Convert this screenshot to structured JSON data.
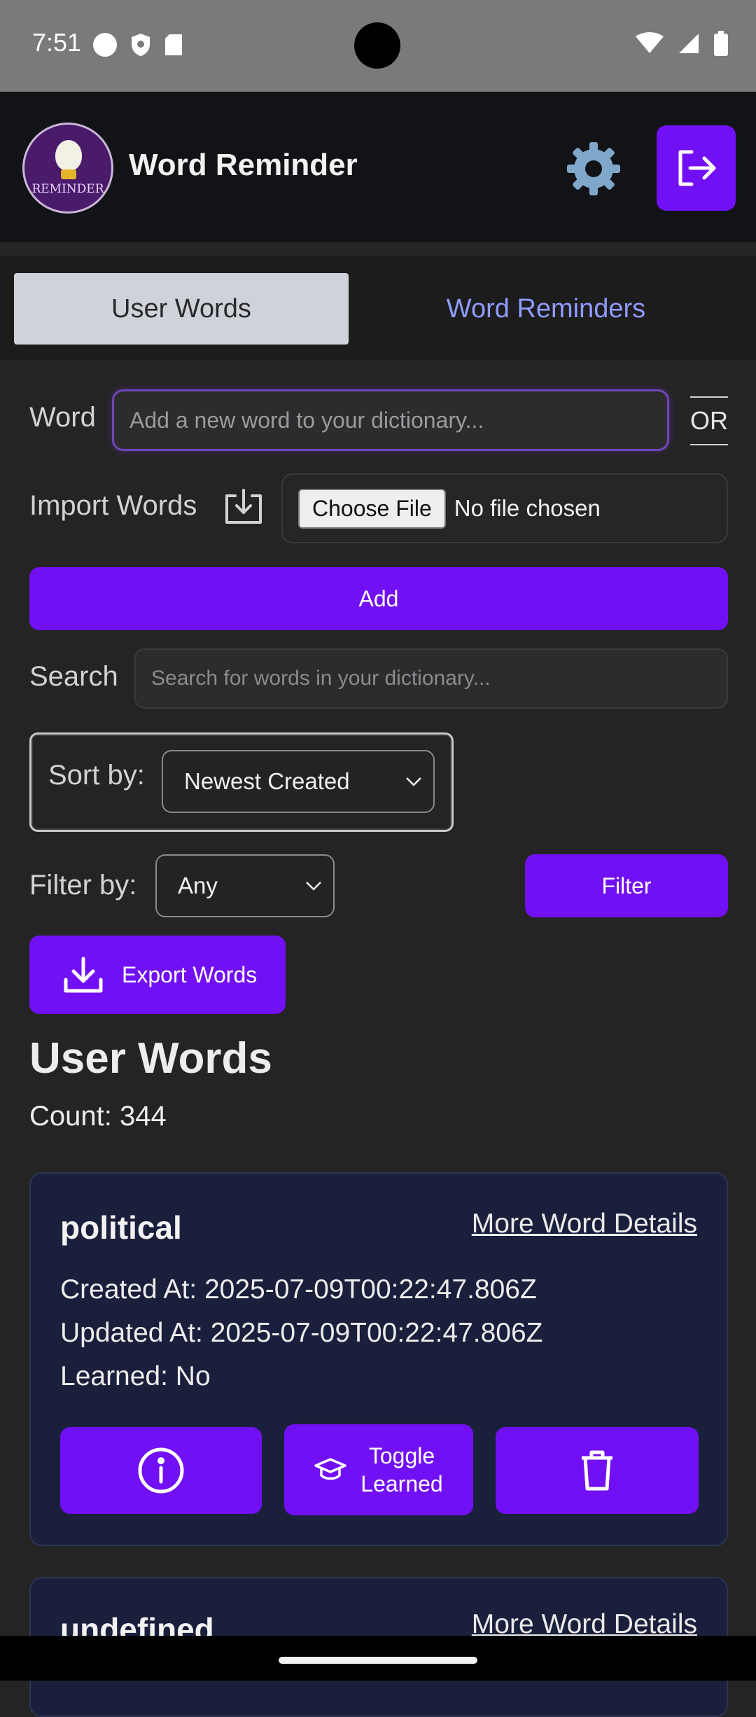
{
  "status_bar": {
    "time": "7:51"
  },
  "header": {
    "title": "Word Reminder",
    "logo_text": "REMINDER"
  },
  "tabs": {
    "user_words": "User Words",
    "word_reminders": "Word Reminders"
  },
  "form": {
    "word_label": "Word",
    "word_placeholder": "Add a new word to your dictionary...",
    "or_text": "OR",
    "import_label": "Import Words",
    "choose_file_label": "Choose File",
    "no_file_text": "No file chosen",
    "add_label": "Add",
    "search_label": "Search",
    "search_placeholder": "Search for words in your dictionary...",
    "sort_label": "Sort by:",
    "sort_value": "Newest Created",
    "filter_label": "Filter by:",
    "filter_value": "Any",
    "filter_button": "Filter",
    "export_button": "Export Words"
  },
  "section": {
    "title": "User Words",
    "count_text": "Count: 344"
  },
  "words": [
    {
      "word": "political",
      "more_details": "More Word Details",
      "created": "Created At: 2025-07-09T00:22:47.806Z",
      "updated": "Updated At: 2025-07-09T00:22:47.806Z",
      "learned": "Learned: No",
      "toggle_line1": "Toggle",
      "toggle_line2": "Learned"
    },
    {
      "word": "undefined",
      "more_details": "More Word Details"
    }
  ],
  "colors": {
    "accent": "#7210f5",
    "card": "#1a1f3b",
    "tab_link": "#8f9bff"
  }
}
